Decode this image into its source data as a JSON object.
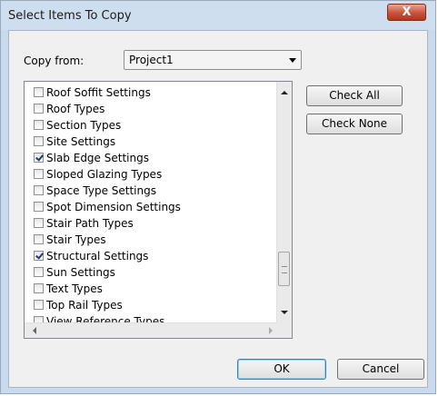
{
  "window": {
    "title": "Select Items To Copy",
    "close_label": "X"
  },
  "copy_from": {
    "label": "Copy from:",
    "value": "Project1"
  },
  "items": [
    {
      "label": "Roof Soffit Settings",
      "checked": false
    },
    {
      "label": "Roof Types",
      "checked": false
    },
    {
      "label": "Section Types",
      "checked": false
    },
    {
      "label": "Site Settings",
      "checked": false
    },
    {
      "label": "Slab Edge Settings",
      "checked": true
    },
    {
      "label": "Sloped Glazing Types",
      "checked": false
    },
    {
      "label": "Space Type Settings",
      "checked": false
    },
    {
      "label": "Spot Dimension Settings",
      "checked": false
    },
    {
      "label": "Stair Path Types",
      "checked": false
    },
    {
      "label": "Stair Types",
      "checked": false
    },
    {
      "label": "Structural Settings",
      "checked": true
    },
    {
      "label": "Sun Settings",
      "checked": false
    },
    {
      "label": "Text Types",
      "checked": false
    },
    {
      "label": "Top Rail Types",
      "checked": false
    },
    {
      "label": "View Reference Types",
      "checked": false
    }
  ],
  "buttons": {
    "check_all": "Check All",
    "check_none": "Check None",
    "ok": "OK",
    "cancel": "Cancel"
  }
}
